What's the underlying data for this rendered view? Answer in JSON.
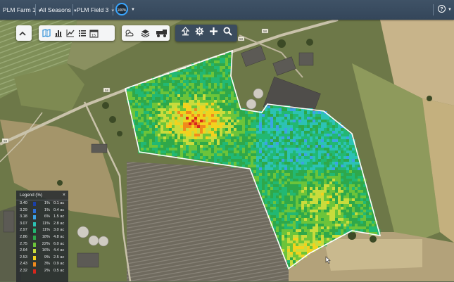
{
  "header": {
    "farm": "PLM Farm 1",
    "season": "All Seasons",
    "field": "PLM Field 3",
    "progress_label": "100%",
    "help_icon": "question-circle-icon"
  },
  "toolbar_left": {
    "icons": [
      "chevron-up-icon",
      "map-book-icon",
      "bar-chart-icon",
      "line-chart-icon",
      "list-icon",
      "calendar-icon"
    ],
    "calendar_day": "15"
  },
  "toolbar_mid": {
    "icons": [
      "weather-icon",
      "layers-icon",
      "machinery-icon"
    ]
  },
  "toolbar_dark": {
    "icons": [
      "share-arrow-icon",
      "gear-icon",
      "plus-icon",
      "search-icon"
    ]
  },
  "road_labels": [
    "58",
    "58",
    "58",
    "58"
  ],
  "legend": {
    "title": "Legend (%)",
    "close": "×",
    "rows": [
      {
        "value": "3.40",
        "pct": "1%",
        "acres": "0.1 ac",
        "color": "#1a3fa8"
      },
      {
        "value": "3.29",
        "pct": "1%",
        "acres": "0.4 ac",
        "color": "#2c6fd6"
      },
      {
        "value": "3.18",
        "pct": "6%",
        "acres": "1.5 ac",
        "color": "#3ca3e6"
      },
      {
        "value": "3.07",
        "pct": "11%",
        "acres": "2.8 ac",
        "color": "#2cc2b4"
      },
      {
        "value": "2.97",
        "pct": "11%",
        "acres": "3.0 ac",
        "color": "#22b873"
      },
      {
        "value": "2.86",
        "pct": "18%",
        "acres": "4.8 ac",
        "color": "#2ea84a"
      },
      {
        "value": "2.75",
        "pct": "22%",
        "acres": "6.0 ac",
        "color": "#6cc43a"
      },
      {
        "value": "2.64",
        "pct": "16%",
        "acres": "4.4 ac",
        "color": "#c9dc3c"
      },
      {
        "value": "2.53",
        "pct": "9%",
        "acres": "2.5 ac",
        "color": "#f2d21e"
      },
      {
        "value": "2.43",
        "pct": "3%",
        "acres": "0.9 ac",
        "color": "#f08a1c"
      },
      {
        "value": "2.32",
        "pct": "2%",
        "acres": "0.5 ac",
        "color": "#d8261c"
      }
    ]
  }
}
